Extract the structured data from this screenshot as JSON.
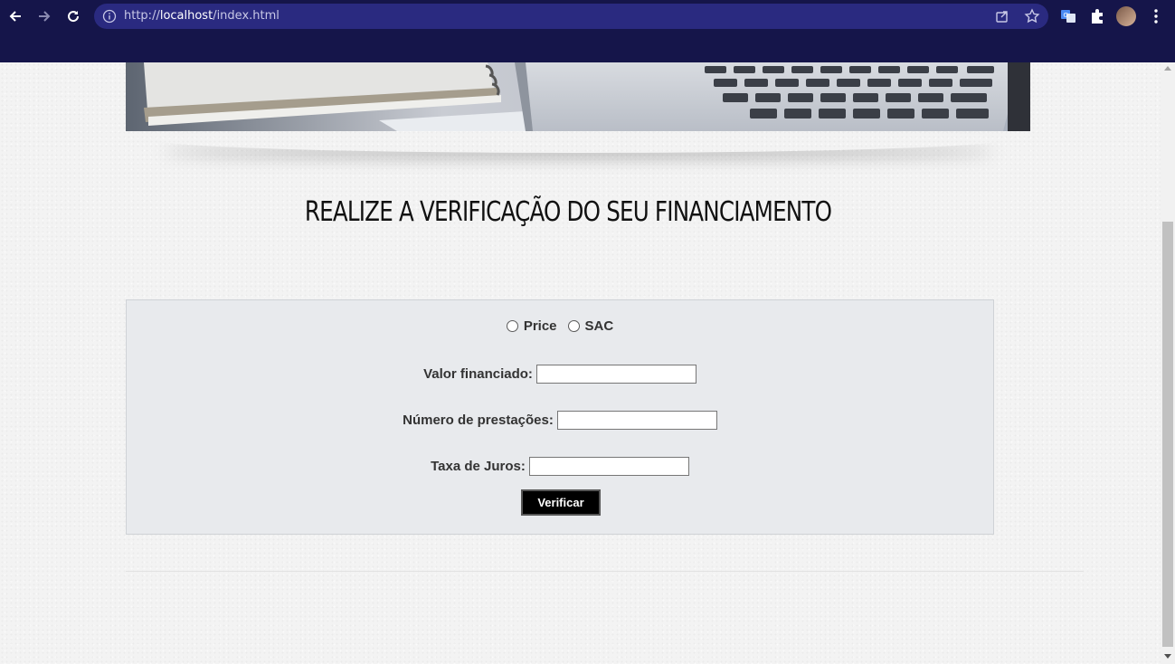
{
  "browser": {
    "url_scheme": "http://",
    "url_host": "localhost",
    "url_path": "/index.html",
    "icons": {
      "back": "back-arrow-icon",
      "forward": "forward-arrow-icon",
      "reload": "reload-icon",
      "info": "info-icon",
      "share": "share-icon",
      "bookmark": "star-icon",
      "translate": "translate-icon",
      "extensions": "puzzle-icon",
      "profile": "avatar",
      "menu": "kebab-menu-icon"
    },
    "colors": {
      "frame": "#15154a",
      "omnibox": "#2a2a80"
    }
  },
  "page": {
    "headline": "REALIZE A VERIFICAÇÃO DO SEU FINANCIAMENTO",
    "form": {
      "options": [
        {
          "label": "Price",
          "selected": false
        },
        {
          "label": "SAC",
          "selected": false
        }
      ],
      "fields": [
        {
          "label": "Valor financiado:",
          "value": ""
        },
        {
          "label": "Número de prestações:",
          "value": ""
        },
        {
          "label": "Taxa de Juros:",
          "value": ""
        }
      ],
      "submit_label": "Verificar"
    },
    "colors": {
      "panel": "#e8eaed",
      "button": "#000000"
    }
  }
}
